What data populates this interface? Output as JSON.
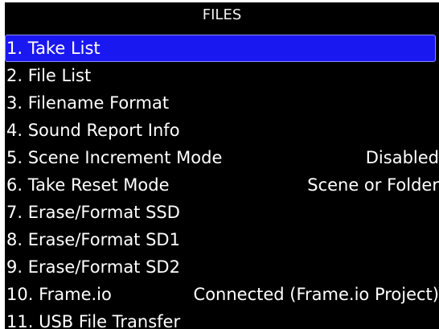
{
  "header": {
    "title": "FILES"
  },
  "menu": {
    "items": [
      {
        "label": "1. Take List",
        "value": ""
      },
      {
        "label": "2. File List",
        "value": ""
      },
      {
        "label": "3. Filename Format",
        "value": ""
      },
      {
        "label": "4. Sound Report Info",
        "value": ""
      },
      {
        "label": "5. Scene Increment Mode",
        "value": "Disabled"
      },
      {
        "label": "6. Take Reset Mode",
        "value": "Scene or Folder"
      },
      {
        "label": "7. Erase/Format SSD",
        "value": ""
      },
      {
        "label": "8. Erase/Format SD1",
        "value": ""
      },
      {
        "label": "9. Erase/Format SD2",
        "value": ""
      },
      {
        "label": "10. Frame.io",
        "value": "Connected (Frame.io Project)"
      },
      {
        "label": "11. USB File Transfer",
        "value": ""
      }
    ],
    "selected_index": 0
  },
  "colors": {
    "background": "#000000",
    "text": "#ffffff",
    "selection": "#1a18f0"
  }
}
